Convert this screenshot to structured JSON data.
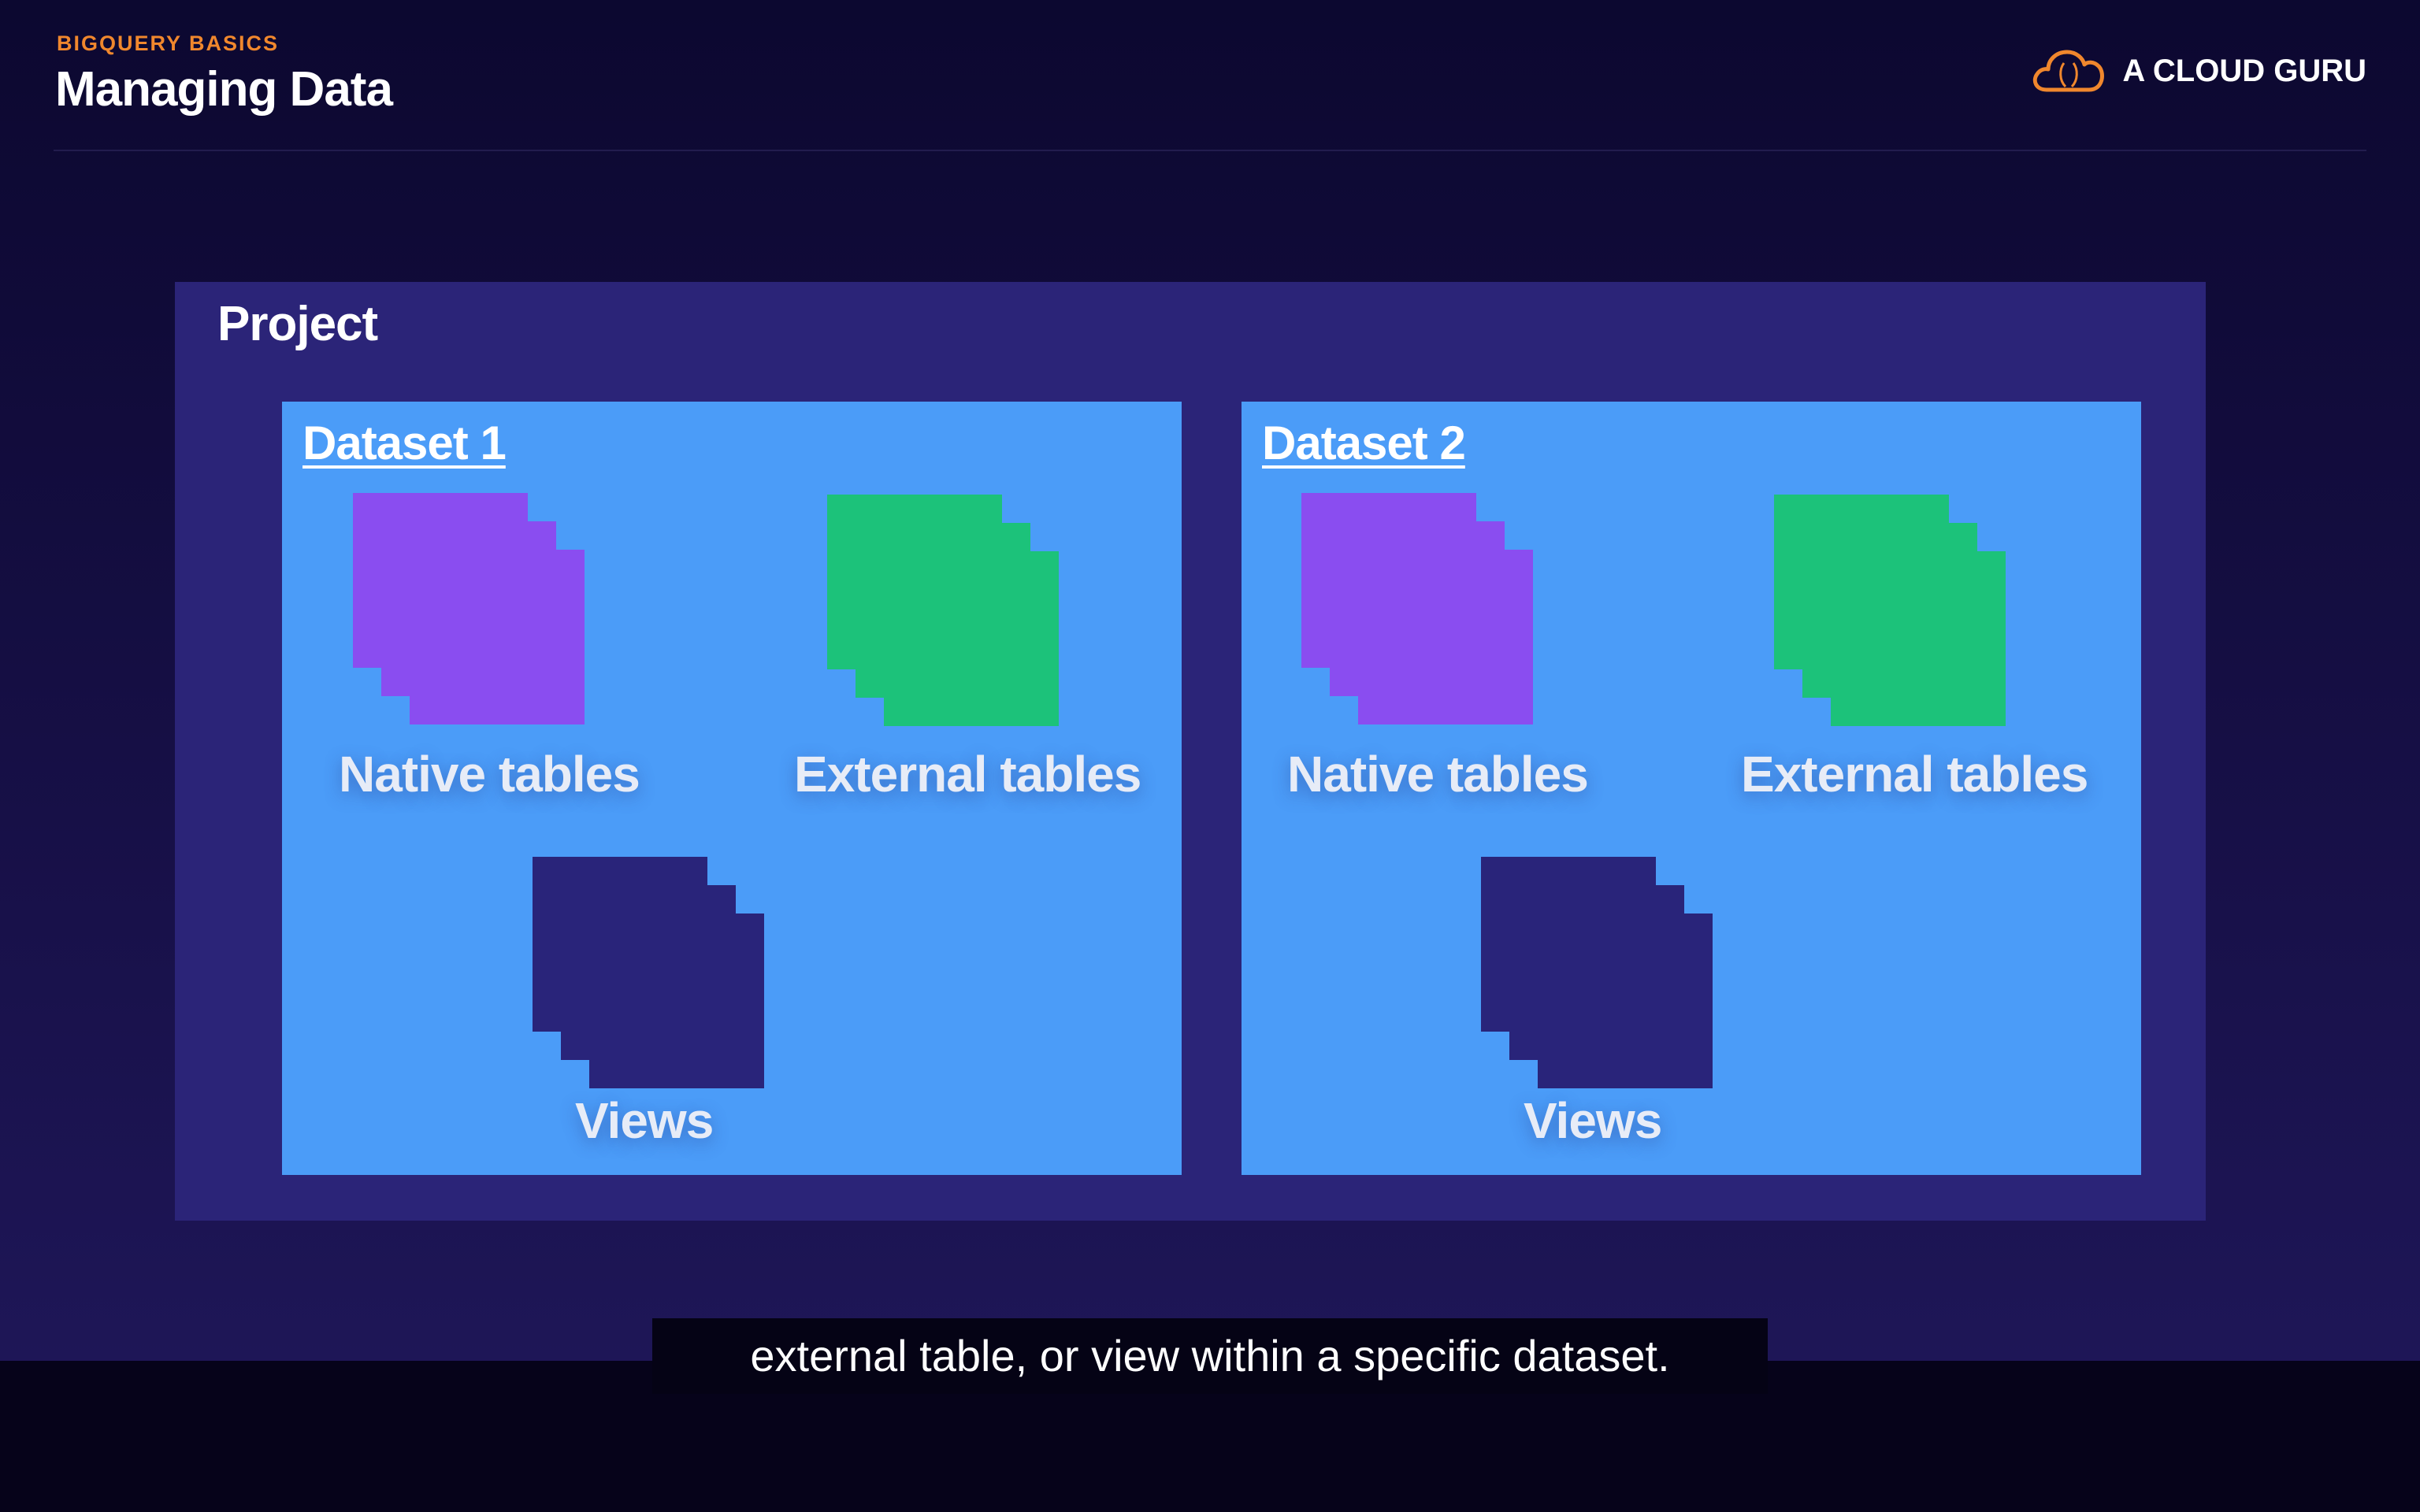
{
  "header": {
    "eyebrow": "BIGQUERY BASICS",
    "title": "Managing Data",
    "brand_name": "A CLOUD GURU",
    "brand_icon": "cloud-icon"
  },
  "diagram": {
    "project_label": "Project",
    "datasets": [
      {
        "label": "Dataset 1",
        "items": {
          "native": "Native tables",
          "external": "External tables",
          "views": "Views"
        }
      },
      {
        "label": "Dataset 2",
        "items": {
          "native": "Native tables",
          "external": "External tables",
          "views": "Views"
        }
      }
    ],
    "colors": {
      "project": "#2b2478",
      "dataset": "#4b9cf8",
      "native": "#8a4df0",
      "external": "#1cc27a",
      "views": "#29247a",
      "accent": "#f0872d"
    }
  },
  "subtitle": "external table, or view within a specific dataset."
}
